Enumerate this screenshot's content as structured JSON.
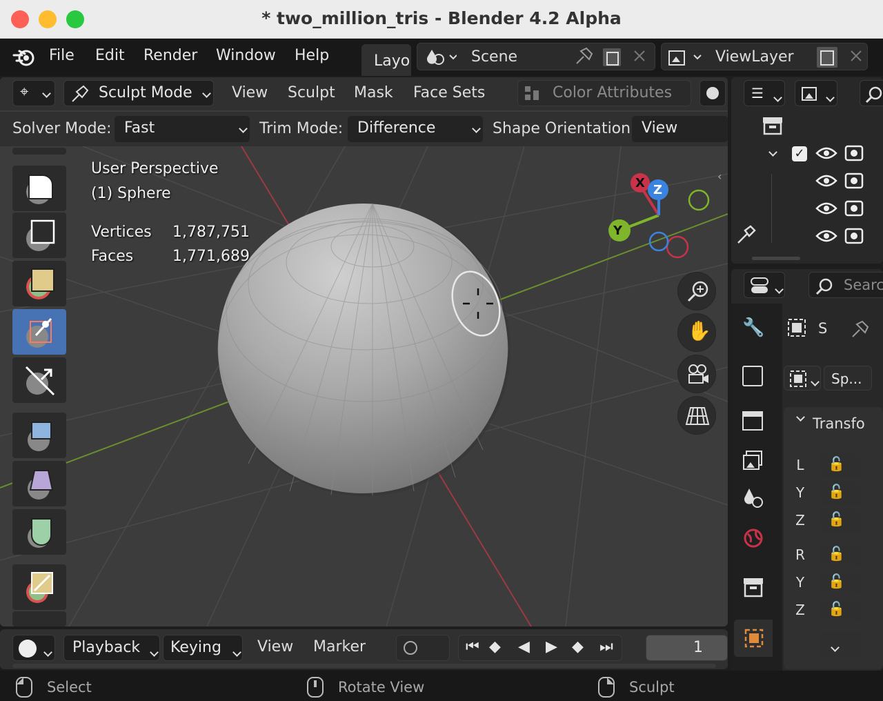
{
  "window": {
    "title": "* two_million_tris - Blender 4.2 Alpha"
  },
  "menubar": {
    "items": [
      "File",
      "Edit",
      "Render",
      "Window",
      "Help"
    ],
    "workspace_tab": "Layo"
  },
  "scene": {
    "label": "Scene"
  },
  "view_layer": {
    "label": "ViewLayer"
  },
  "viewport_header": {
    "mode": "Sculpt Mode",
    "menus": [
      "View",
      "Sculpt",
      "Mask",
      "Face Sets"
    ],
    "color_attributes": "Color Attributes"
  },
  "tool_settings": {
    "solver_label": "Solver Mode:",
    "solver_value": "Fast",
    "trim_label": "Trim Mode:",
    "trim_value": "Difference",
    "shape_label": "Shape Orientation:",
    "shape_value": "View"
  },
  "overlay": {
    "perspective": "User Perspective",
    "object": "(1) Sphere",
    "vertices_label": "Vertices",
    "vertices_value": "1,787,751",
    "faces_label": "Faces",
    "faces_value": "1,771,689"
  },
  "gizmo": {
    "x": "X",
    "y": "Y",
    "z": "Z"
  },
  "properties": {
    "search_placeholder": "Searc",
    "object_short": "S",
    "data_short": "Sp...",
    "panel_title": "Transfo",
    "rows": [
      "L",
      "Y",
      "Z",
      "R",
      "Y",
      "Z"
    ]
  },
  "timeline": {
    "menus": [
      "Playback",
      "Keying",
      "View",
      "Marker"
    ],
    "frame": "1"
  },
  "statusbar": {
    "select": "Select",
    "rotate": "Rotate View",
    "sculpt": "Sculpt"
  },
  "colors": {
    "accent": "#4772b3",
    "x_axis": "#c8334a",
    "y_axis": "#7fb52a",
    "z_axis": "#3b83e0"
  }
}
